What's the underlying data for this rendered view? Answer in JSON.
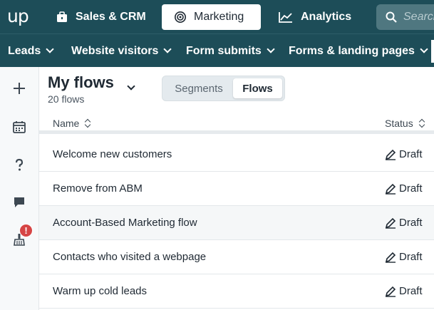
{
  "app": {
    "logo": "up"
  },
  "topnav": {
    "tabs": [
      {
        "label": "Sales & CRM",
        "icon": "briefcase-icon"
      },
      {
        "label": "Marketing",
        "icon": "target-icon",
        "active": true
      },
      {
        "label": "Analytics",
        "icon": "chart-line-icon"
      }
    ],
    "search_placeholder": "Search"
  },
  "subnav": {
    "items": [
      {
        "label": "Leads"
      },
      {
        "label": "Website visitors"
      },
      {
        "label": "Form submits"
      },
      {
        "label": "Forms & landing pages"
      }
    ]
  },
  "rail": {
    "items": [
      {
        "icon": "plus-icon"
      },
      {
        "icon": "calendar-icon"
      },
      {
        "icon": "help-icon"
      },
      {
        "icon": "chat-icon"
      },
      {
        "icon": "broom-icon",
        "badge": "!"
      }
    ]
  },
  "page": {
    "title": "My flows",
    "subtitle": "20 flows",
    "segments": [
      {
        "label": "Segments"
      },
      {
        "label": "Flows",
        "active": true
      }
    ]
  },
  "table": {
    "columns": [
      "Name",
      "Status"
    ],
    "rows": [
      {
        "name": "Welcome new customers",
        "status": "Draft"
      },
      {
        "name": "Remove from ABM",
        "status": "Draft"
      },
      {
        "name": "Account-Based Marketing flow",
        "status": "Draft"
      },
      {
        "name": "Contacts who visited a webpage",
        "status": "Draft"
      },
      {
        "name": "Warm up cold leads",
        "status": "Draft"
      }
    ]
  },
  "colors": {
    "topbar": "#1d4d58",
    "badge": "#d64545"
  }
}
